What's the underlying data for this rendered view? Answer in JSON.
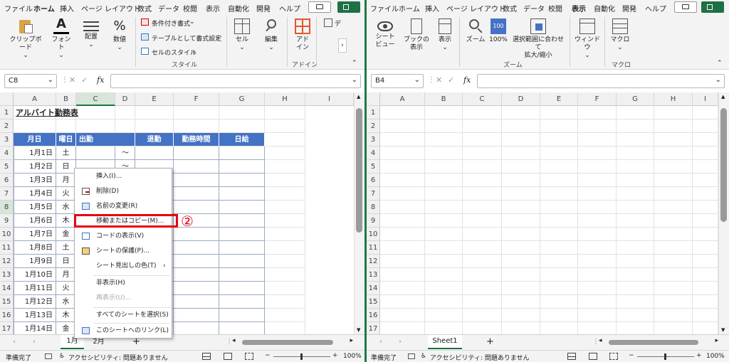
{
  "left": {
    "tabs": [
      "ファイル",
      "ホーム",
      "挿入",
      "ページ レイアウト",
      "数式",
      "データ",
      "校閲",
      "表示",
      "自動化",
      "開発",
      "ヘルプ"
    ],
    "active_tab": "ホーム",
    "ribbon": {
      "clipboard": "クリップボード",
      "font": "フォント",
      "alignment": "配置",
      "number": "数値",
      "conditional": "条件付き書式",
      "table_format": "テーブルとして書式設定",
      "cell_style": "セルのスタイル",
      "style_group": "スタイル",
      "cells": "セル",
      "editing": "編集",
      "addin": "アド\nイン",
      "addin_group": "アドイン",
      "truncated": "デ"
    },
    "name_box": "C8",
    "fx": "fx",
    "columns": [
      "A",
      "B",
      "C",
      "D",
      "E",
      "F",
      "G",
      "H",
      "I"
    ],
    "rows": [
      "1",
      "2",
      "3",
      "4",
      "5",
      "6",
      "7",
      "8",
      "9",
      "10",
      "11",
      "12",
      "13",
      "14",
      "15",
      "16",
      "17"
    ],
    "title": "アルバイト勤務表",
    "headers": {
      "date": "月日",
      "weekday": "曜日",
      "start": "出勤",
      "end": "退勤",
      "hours": "勤務時間",
      "pay": "日給"
    },
    "tilde": "～",
    "dates": [
      "1月1日",
      "1月2日",
      "1月3日",
      "1月4日",
      "1月5日",
      "1月6日",
      "1月7日",
      "1月8日",
      "1月9日",
      "1月10日",
      "1月11日",
      "1月12日",
      "1月13日",
      "1月14日"
    ],
    "weekdays": [
      "土",
      "日",
      "月",
      "火",
      "水",
      "木",
      "金",
      "土",
      "日",
      "月",
      "火",
      "水",
      "木",
      "金"
    ],
    "sheets": [
      "1月",
      "2月"
    ],
    "add_sheet": "+",
    "status": {
      "ready": "準備完了",
      "accessibility": "アクセシビリティ: 問題ありません",
      "zoom": "100%"
    },
    "menu": {
      "insert": "挿入(I)...",
      "delete": "削除(D)",
      "rename": "名前の変更(R)",
      "move_copy": "移動またはコピー(M)...",
      "view_code": "コードの表示(V)",
      "protect": "シートの保護(P)...",
      "tab_color": "シート見出しの色(T)",
      "hide": "非表示(H)",
      "unhide": "再表示(U)...",
      "select_all": "すべてのシートを選択(S)",
      "link": "このシートへのリンク(L)"
    },
    "annotation": "②"
  },
  "right": {
    "tabs": [
      "ファイル",
      "ホーム",
      "挿入",
      "ページ レイアウト",
      "数式",
      "データ",
      "校閲",
      "表示",
      "自動化",
      "開発",
      "ヘルプ"
    ],
    "active_tab": "表示",
    "ribbon": {
      "sheet_view": "シート\nビュー",
      "book_view": "ブックの\n表示",
      "show": "表示",
      "zoom": "ズーム",
      "zoom100": "100%",
      "zoom_selection": "選択範囲に合わせて\n拡大/縮小",
      "zoom_group": "ズーム",
      "window": "ウィンドウ",
      "macro": "マクロ",
      "macro_group": "マクロ"
    },
    "name_box": "B4",
    "fx": "fx",
    "columns": [
      "A",
      "B",
      "C",
      "D",
      "E",
      "F",
      "G",
      "H",
      "I"
    ],
    "rows": [
      "1",
      "2",
      "3",
      "4",
      "5",
      "6",
      "7",
      "8",
      "9",
      "10",
      "11",
      "12",
      "13",
      "14",
      "15",
      "16",
      "17"
    ],
    "sheets": [
      "Sheet1"
    ],
    "add_sheet": "+",
    "status": {
      "ready": "準備完了",
      "accessibility": "アクセシビリティ: 問題ありません",
      "zoom": "100%"
    }
  },
  "colors": {
    "header_blue": "#4472c4",
    "accent_green": "#1e7145",
    "annotation_red": "#e60012"
  }
}
